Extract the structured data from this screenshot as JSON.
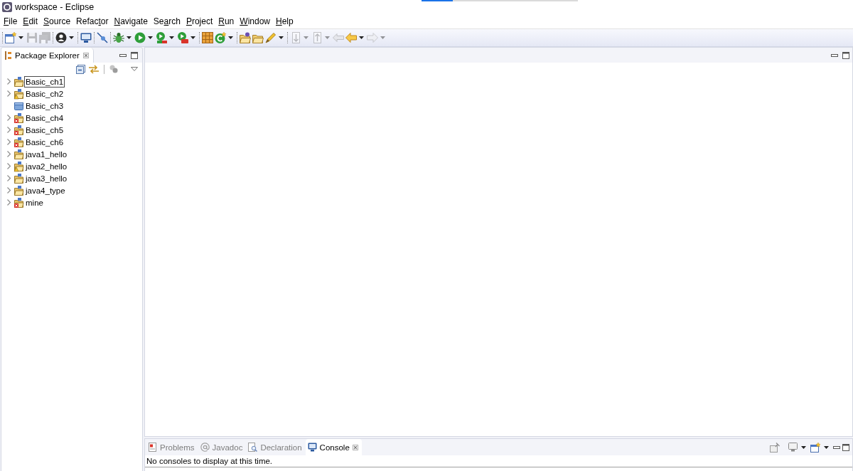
{
  "window": {
    "title": "workspace - Eclipse"
  },
  "loading_bar": {
    "level": 0.2
  },
  "menu": [
    {
      "key": "F",
      "post": "ile"
    },
    {
      "key": "E",
      "post": "dit"
    },
    {
      "key": "S",
      "post": "ource"
    },
    {
      "pre": "Refac",
      "key": "t",
      "post": "or"
    },
    {
      "key": "N",
      "post": "avigate"
    },
    {
      "pre": "Se",
      "key": "a",
      "post": "rch"
    },
    {
      "key": "P",
      "post": "roject"
    },
    {
      "key": "R",
      "post": "un"
    },
    {
      "key": "W",
      "post": "indow"
    },
    {
      "key": "H",
      "post": "elp"
    }
  ],
  "toolbar": {
    "groups": [
      [
        {
          "disabled": false,
          "dropdown": true
        },
        {
          "disabled": true,
          "dropdown": false
        },
        {
          "disabled": true,
          "dropdown": false
        }
      ],
      [
        {
          "disabled": false,
          "dropdown": true
        }
      ],
      [
        {
          "disabled": false,
          "dropdown": false
        }
      ],
      [
        {
          "disabled": false,
          "dropdown": false
        }
      ],
      [
        {
          "disabled": false,
          "dropdown": true
        },
        {
          "disabled": false,
          "dropdown": true
        },
        {
          "disabled": false,
          "dropdown": true
        },
        {
          "disabled": false,
          "dropdown": true
        }
      ],
      [
        {
          "disabled": false,
          "dropdown": false
        },
        {
          "disabled": false,
          "dropdown": true
        }
      ],
      [
        {
          "disabled": false,
          "dropdown": false
        },
        {
          "disabled": false,
          "dropdown": false
        },
        {
          "disabled": false,
          "dropdown": true
        }
      ],
      [
        {
          "disabled": true,
          "dropdown": true
        },
        {
          "disabled": true,
          "dropdown": true
        },
        {
          "disabled": true,
          "dropdown": false
        },
        {
          "disabled": false,
          "dropdown": true
        },
        {
          "disabled": true,
          "dropdown": true
        }
      ]
    ]
  },
  "package_explorer": {
    "title": "Package Explorer",
    "tree": [
      {
        "label": "Basic_ch1",
        "open": true,
        "expanded": false,
        "selected": true,
        "warning": false,
        "error": false
      },
      {
        "label": "Basic_ch2",
        "open": true,
        "expanded": false,
        "selected": false,
        "warning": true,
        "error": false
      },
      {
        "label": "Basic_ch3",
        "open": false,
        "selected": false,
        "warning": false,
        "error": false
      },
      {
        "label": "Basic_ch4",
        "open": true,
        "expanded": false,
        "selected": false,
        "warning": false,
        "error": true
      },
      {
        "label": "Basic_ch5",
        "open": true,
        "expanded": false,
        "selected": false,
        "warning": false,
        "error": true
      },
      {
        "label": "Basic_ch6",
        "open": true,
        "expanded": false,
        "selected": false,
        "warning": false,
        "error": true
      },
      {
        "label": "java1_hello",
        "open": true,
        "expanded": false,
        "selected": false,
        "warning": false,
        "error": false
      },
      {
        "label": "java2_hello",
        "open": true,
        "expanded": false,
        "selected": false,
        "warning": true,
        "error": false
      },
      {
        "label": "java3_hello",
        "open": true,
        "expanded": false,
        "selected": false,
        "warning": false,
        "error": false
      },
      {
        "label": "java4_type",
        "open": true,
        "expanded": false,
        "selected": false,
        "warning": false,
        "error": false
      },
      {
        "label": "mine",
        "open": true,
        "expanded": false,
        "selected": false,
        "warning": false,
        "error": true
      }
    ]
  },
  "bottom_panel": {
    "tabs": [
      {
        "label": "Problems",
        "selected": false
      },
      {
        "label": "Javadoc",
        "selected": false
      },
      {
        "label": "Declaration",
        "selected": false
      },
      {
        "label": "Console",
        "selected": true
      }
    ],
    "message": "No consoles to display at this time."
  }
}
